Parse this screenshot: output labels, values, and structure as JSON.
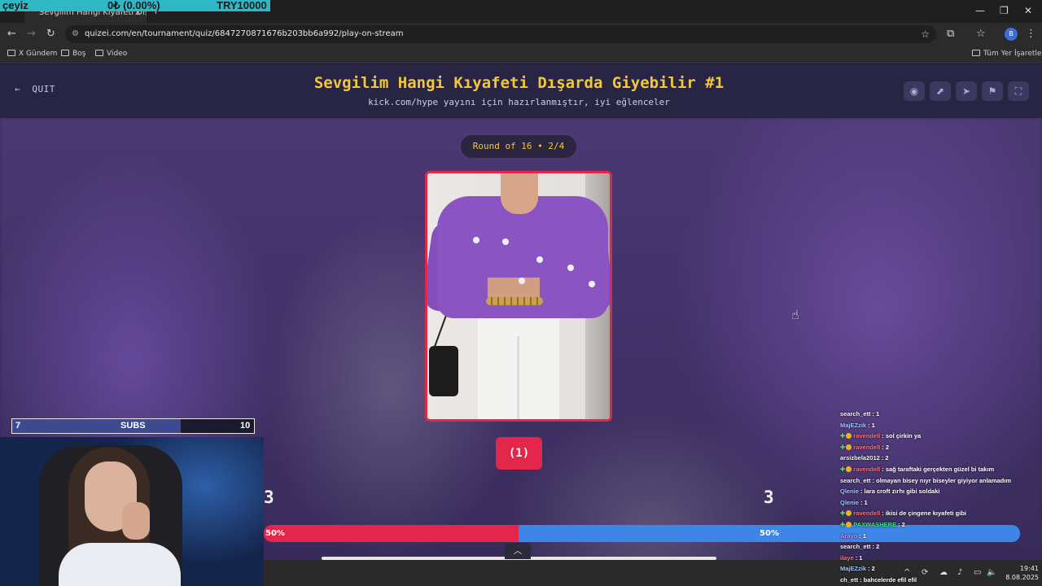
{
  "browser": {
    "tab_title": "Sevgilim Hangi Kıyafeti Dışard...",
    "tab_close": "✕",
    "new_tab": "+",
    "url": "quizei.com/en/tournament/quiz/6847270871676b203bb6a992/play-on-stream",
    "bookmarks": [
      "X Gündem",
      "Boş",
      "Video"
    ],
    "all_bookmarks": "Tüm Yer İşaretleri",
    "profile_initial": "B",
    "window_controls": {
      "minimize": "—",
      "restore": "❐",
      "close": "✕"
    }
  },
  "stream_overlay": {
    "name": "çeyiz",
    "balance": "0₺ (0.00%)",
    "goal": "TRY10000",
    "subs": {
      "label": "SUBS",
      "current": "7",
      "target": "10"
    }
  },
  "quiz": {
    "quit_label": "QUIT",
    "title": "Sevgilim Hangi Kıyafeti Dışarda Giyebilir #1",
    "subtitle": "kick.com/hype yayını için hazırlanmıştır, iyi eğlenceler",
    "round_label": "Round of 16 • 2/4",
    "vote_button": "(1)",
    "left_score": "3",
    "right_score": "3",
    "left_percent_text": "50%",
    "right_percent_text": "50%",
    "left_percent": 50,
    "right_percent": 50
  },
  "colors": {
    "accent_yellow": "#f3c63d",
    "vote_red": "#e3264a",
    "vote_blue": "#3d86e8",
    "header_bg": "#272543"
  },
  "chat": [
    {
      "user": "search_ett",
      "text": ": 1",
      "color": "u-white",
      "badge": false
    },
    {
      "user": "MajEZzik",
      "text": ": 1",
      "color": "u-blue",
      "badge": false
    },
    {
      "user": "ravendell",
      "text": ": sol çirkin ya",
      "color": "u-red",
      "badge": true
    },
    {
      "user": "ravendell",
      "text": ": 2",
      "color": "u-red",
      "badge": true
    },
    {
      "user": "arsizbela2012",
      "text": ": 2",
      "color": "u-white",
      "badge": false
    },
    {
      "user": "ravendell",
      "text": ": sağ taraftaki gerçekten güzel bi takım",
      "color": "u-red",
      "badge": true
    },
    {
      "user": "search_ett",
      "text": ": olmayan bisey nıyr biseyler giyiyor anlamadım",
      "color": "u-white",
      "badge": false
    },
    {
      "user": "Qlenie",
      "text": ": lara croft zırhı gibi soldaki",
      "color": "u-blue",
      "badge": false
    },
    {
      "user": "Qlenie",
      "text": ": 1",
      "color": "u-blue",
      "badge": false
    },
    {
      "user": "ravendell",
      "text": ": ikisi de çingene kıyafeti gibi",
      "color": "u-red",
      "badge": true
    },
    {
      "user": "PAXWASHERE",
      "text": ": 2",
      "color": "u-green",
      "badge": true
    },
    {
      "user": "Arayo",
      "text": ": 1",
      "color": "u-purple",
      "badge": false
    },
    {
      "user": "search_ett",
      "text": ": 2",
      "color": "u-white",
      "badge": false
    },
    {
      "user": "ilaye",
      "text": ": 1",
      "color": "u-red",
      "badge": false
    },
    {
      "user": "MajEZzik",
      "text": ": 2",
      "color": "u-blue",
      "badge": false
    },
    {
      "user": "ch_ett",
      "text": ": bahcelerde efil efil",
      "color": "u-white",
      "badge": false
    }
  ],
  "clock": {
    "time": "19:41",
    "date": "8.08.2025"
  }
}
